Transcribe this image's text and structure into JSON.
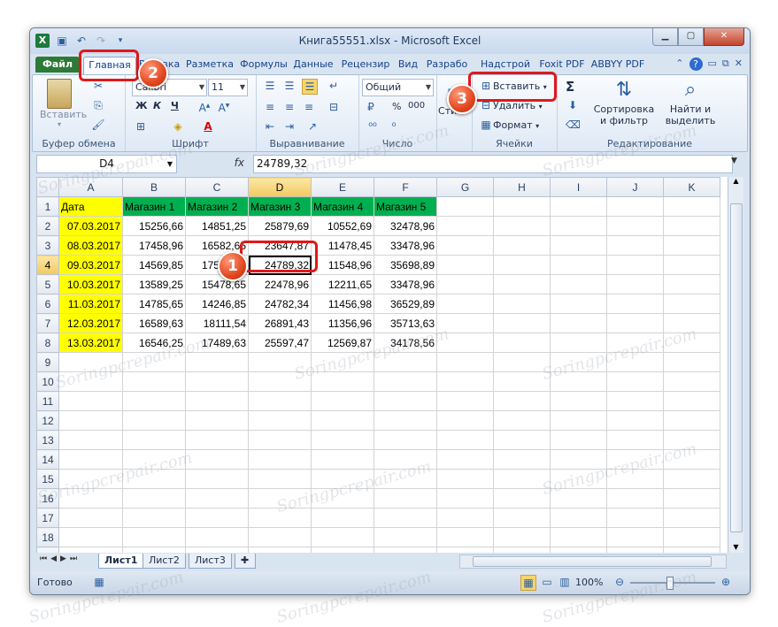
{
  "window": {
    "title": "Книга55551.xlsx - Microsoft Excel",
    "quick_access": [
      "save-icon",
      "undo-icon",
      "redo-icon"
    ]
  },
  "tabs": [
    "Файл",
    "Главная",
    "Вставка",
    "Разметка",
    "Формулы",
    "Данные",
    "Рецензир",
    "Вид",
    "Разрабо",
    "Надстрой",
    "Foxit PDF",
    "ABBYY PDF"
  ],
  "ribbon": {
    "clipboard": {
      "paste": "Вставить",
      "label": "Буфер обмена"
    },
    "font": {
      "name": "Calibri",
      "size": "11",
      "label": "Шрифт",
      "bold": "Ж",
      "italic": "К",
      "underline": "Ч"
    },
    "alignment": {
      "label": "Выравнивание"
    },
    "number": {
      "format": "Общий",
      "percent": "%",
      "thousands": "000",
      "label": "Число"
    },
    "styles": {
      "label": "Сти"
    },
    "cells": {
      "insert": "Вставить",
      "delete": "Удалить",
      "format": "Формат",
      "label": "Ячейки"
    },
    "editing": {
      "sum": "Σ",
      "sort": "Сортировка\nи фильтр",
      "sort_l1": "Сортировка",
      "sort_l2": "и фильтр",
      "find_l1": "Найти и",
      "find_l2": "выделить",
      "label": "Редактирование"
    }
  },
  "formula_bar": {
    "name_box": "D4",
    "fx": "fx",
    "value": "24789,32"
  },
  "sheet": {
    "columns": [
      "A",
      "B",
      "C",
      "D",
      "E",
      "F",
      "G",
      "H",
      "I",
      "J",
      "K"
    ],
    "selected_column": "D",
    "selected_row": 4,
    "header_row": [
      "Дата",
      "Магазин 1",
      "Магазин 2",
      "Магазин 3",
      "Магазин 4",
      "Магазин 5"
    ],
    "rows": [
      [
        "07.03.2017",
        "15256,66",
        "14851,25",
        "25879,69",
        "10552,69",
        "32478,96"
      ],
      [
        "08.03.2017",
        "17458,96",
        "16582,65",
        "23647,87",
        "11478,45",
        "33478,96"
      ],
      [
        "09.03.2017",
        "14569,85",
        "17589,58",
        "24789,32",
        "11548,96",
        "35698,89"
      ],
      [
        "10.03.2017",
        "13589,25",
        "15478,65",
        "22478,96",
        "12211,65",
        "33478,96"
      ],
      [
        "11.03.2017",
        "14785,65",
        "14246,85",
        "24782,34",
        "11456,98",
        "36529,89"
      ],
      [
        "12.03.2017",
        "16589,63",
        "18111,54",
        "26891,43",
        "11356,96",
        "35713,63"
      ],
      [
        "13.03.2017",
        "16546,25",
        "17489,63",
        "25597,47",
        "12569,87",
        "34178,56"
      ]
    ],
    "total_rows": 21,
    "sheet_tabs": [
      "Лист1",
      "Лист2",
      "Лист3"
    ],
    "active_sheet": "Лист1"
  },
  "status": {
    "ready": "Готово",
    "zoom": "100%"
  },
  "annotations": [
    "1",
    "2",
    "3"
  ],
  "watermark": "Soringpcrepair.com",
  "colors": {
    "header_green": "#00b050",
    "date_yellow": "#ffff00",
    "annotation_red": "#e0181b",
    "file_tab": "#2c7a36"
  }
}
